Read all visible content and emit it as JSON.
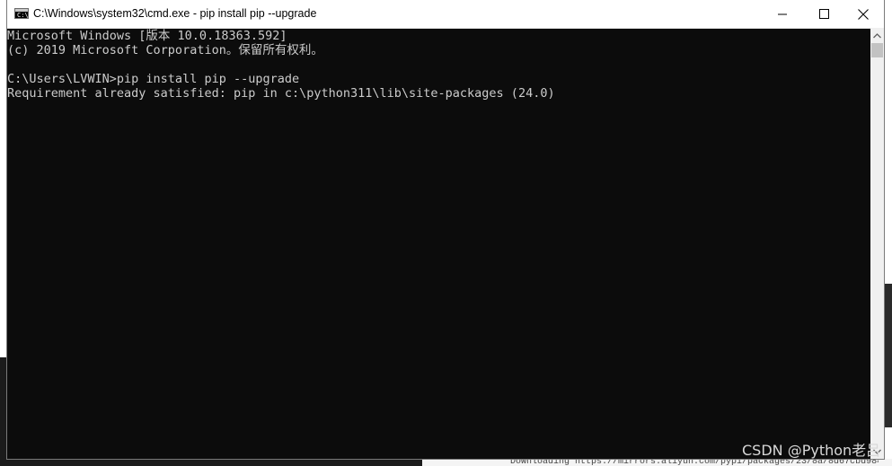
{
  "window": {
    "title": "C:\\Windows\\system32\\cmd.exe - pip  install pip --upgrade",
    "icon": "cmd-icon",
    "icon_text": "C:\\"
  },
  "controls": {
    "minimize_icon": "minimize-icon",
    "maximize_icon": "maximize-icon",
    "close_icon": "close-icon"
  },
  "console": {
    "lines": [
      "Microsoft Windows [版本 10.0.18363.592]",
      "(c) 2019 Microsoft Corporation。保留所有权利。",
      "",
      "C:\\Users\\LVWIN>pip install pip --upgrade",
      "Requirement already satisfied: pip in c:\\python311\\lib\\site-packages (24.0)"
    ],
    "foreground": "#cccccc",
    "background": "#0c0c0c"
  },
  "background_text": "Downloading https://mirrors.aliyun.com/pypi/packages/23/8a/8d67cbd9847324",
  "watermark": "CSDN @Python老吕"
}
